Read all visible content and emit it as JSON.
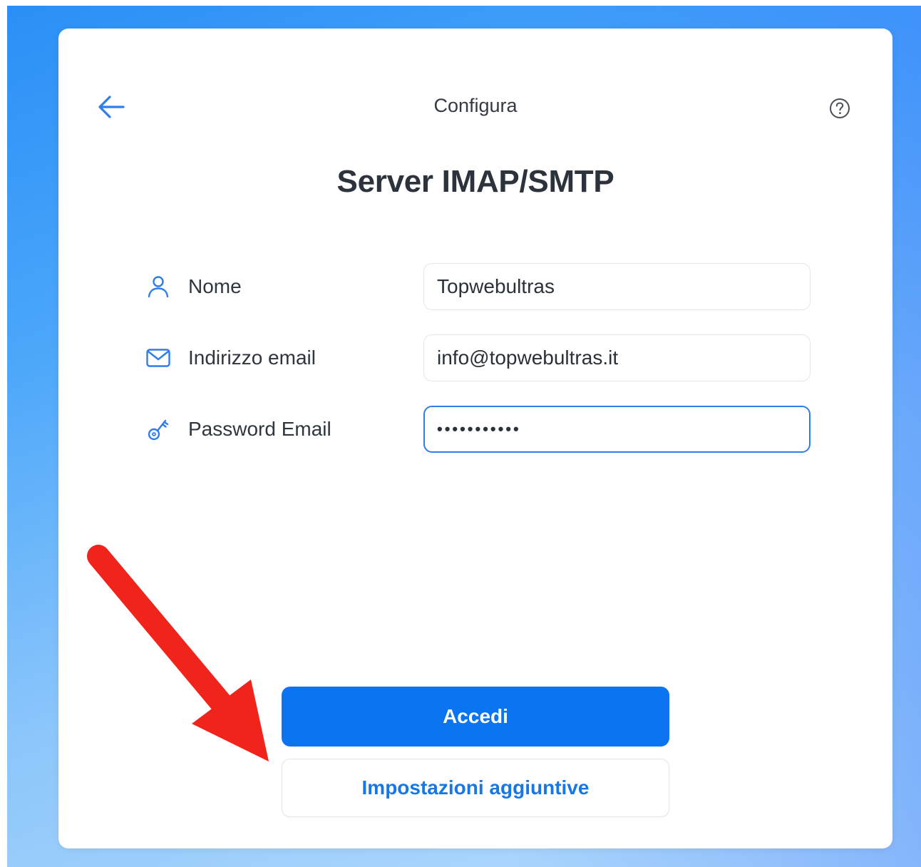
{
  "header": {
    "title": "Configura",
    "back_icon": "arrow-left-icon",
    "help_icon": "question-circle-icon"
  },
  "page": {
    "title": "Server IMAP/SMTP"
  },
  "form": {
    "fields": [
      {
        "label": "Nome",
        "icon": "user-icon",
        "value": "Topwebultras"
      },
      {
        "label": "Indirizzo email",
        "icon": "envelope-icon",
        "value": "info@topwebultras.it"
      },
      {
        "label": "Password Email",
        "icon": "key-icon",
        "value": "•••••••••••"
      }
    ]
  },
  "actions": {
    "primary_label": "Accedi",
    "secondary_label": "Impostazioni aggiuntive"
  },
  "annotation": {
    "icon": "red-arrow-annotation",
    "color": "#f0241b"
  },
  "colors": {
    "accent": "#0b74f0",
    "link": "#1677e6",
    "icon_blue": "#2f7de8",
    "focus_border": "#2f7de8"
  }
}
